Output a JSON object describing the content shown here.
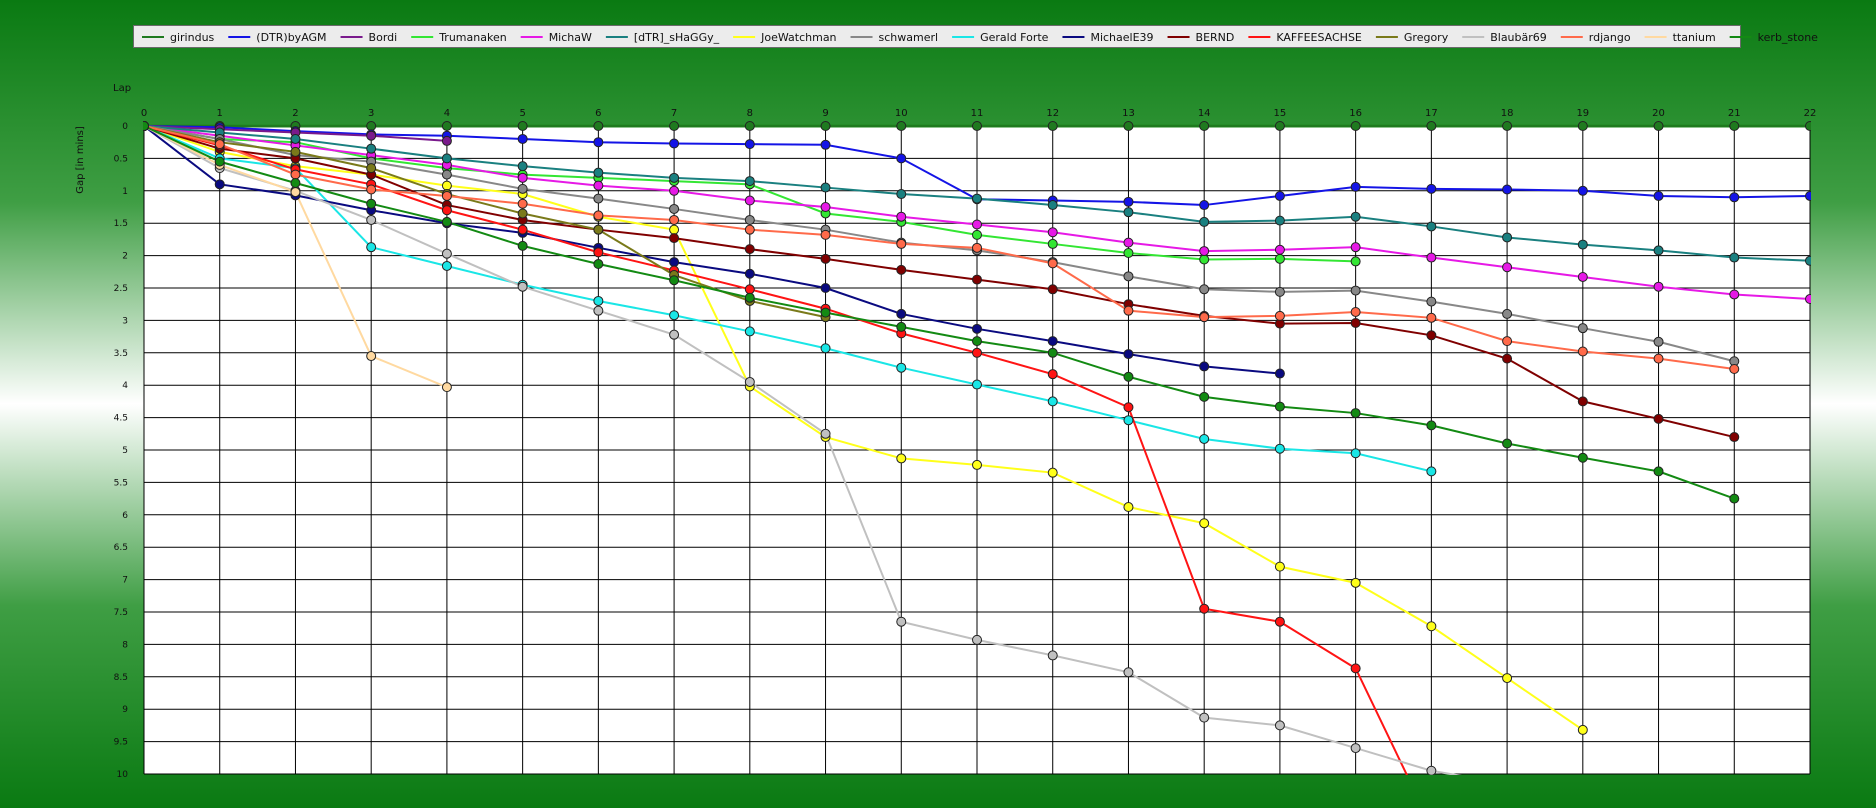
{
  "chart_data": {
    "type": "line",
    "x_label": "Lap",
    "y_label": "Gap [in mins]",
    "x": [
      0,
      1,
      2,
      3,
      4,
      5,
      6,
      7,
      8,
      9,
      10,
      11,
      12,
      13,
      14,
      15,
      16,
      17,
      18,
      19,
      20,
      21,
      22
    ],
    "xlim": [
      0,
      22
    ],
    "ylim": [
      0,
      10
    ],
    "y_inverted": true,
    "y_ticks": [
      "0",
      "0.5",
      "1",
      "1.5",
      "2",
      "2.5",
      "3",
      "3.5",
      "4",
      "4.5",
      "5",
      "5.5",
      "6",
      "6.5",
      "7",
      "7.5",
      "8",
      "8.5",
      "9",
      "9.5",
      "10"
    ],
    "grid": true,
    "legend_position": "top",
    "series": [
      {
        "name": "girindus",
        "color": "#1f7a1f",
        "values": [
          0,
          0,
          0,
          0,
          0,
          0,
          0,
          0,
          0,
          0,
          0,
          0,
          0,
          0,
          0,
          0,
          0,
          0,
          0,
          0,
          0,
          0,
          0
        ]
      },
      {
        "name": "(DTR)byAGM",
        "color": "#1414e6",
        "values": [
          0,
          0.02,
          0.08,
          0.13,
          0.15,
          0.2,
          0.25,
          0.27,
          0.28,
          0.29,
          0.5,
          1.13,
          1.15,
          1.17,
          1.22,
          1.08,
          0.94,
          0.97,
          0.98,
          1.0,
          1.08,
          1.1,
          1.08
        ]
      },
      {
        "name": "Bordi",
        "color": "#7a1a8c",
        "values": [
          0,
          0.05,
          0.1,
          0.15,
          0.23
        ]
      },
      {
        "name": "Trumanaken",
        "color": "#33e633",
        "values": [
          0,
          0.2,
          0.25,
          0.5,
          0.65,
          0.75,
          0.8,
          0.85,
          0.9,
          1.35,
          1.48,
          1.68,
          1.82,
          1.96,
          2.06,
          2.05,
          2.09
        ]
      },
      {
        "name": "MichaW",
        "color": "#e619e6",
        "values": [
          0,
          0.15,
          0.3,
          0.45,
          0.6,
          0.8,
          0.92,
          1.0,
          1.15,
          1.25,
          1.4,
          1.52,
          1.64,
          1.8,
          1.93,
          1.91,
          1.87,
          2.03,
          2.18,
          2.33,
          2.48,
          2.6,
          2.67
        ]
      },
      {
        "name": "[dTR]_sHaGGy_",
        "color": "#1a8080",
        "values": [
          0,
          0.1,
          0.2,
          0.35,
          0.5,
          0.62,
          0.72,
          0.8,
          0.85,
          0.95,
          1.05,
          1.12,
          1.22,
          1.33,
          1.48,
          1.46,
          1.4,
          1.55,
          1.72,
          1.83,
          1.92,
          2.03,
          2.08
        ]
      },
      {
        "name": "JoeWatchman",
        "color": "#ffff1a",
        "values": [
          0,
          0.4,
          0.62,
          0.75,
          0.92,
          1.05,
          1.4,
          1.6,
          4.02,
          4.8,
          5.13,
          5.23,
          5.35,
          5.88,
          6.13,
          6.8,
          7.05,
          7.72,
          8.52,
          9.32
        ]
      },
      {
        "name": "schwamerl",
        "color": "#888888",
        "values": [
          0,
          0.2,
          0.45,
          0.55,
          0.75,
          0.97,
          1.12,
          1.28,
          1.45,
          1.6,
          1.8,
          1.92,
          2.1,
          2.32,
          2.52,
          2.56,
          2.54,
          2.71,
          2.9,
          3.12,
          3.33,
          3.63
        ]
      },
      {
        "name": "Gerald Forte",
        "color": "#1ae6e6",
        "values": [
          0,
          0.5,
          0.65,
          1.87,
          2.16,
          2.45,
          2.7,
          2.92,
          3.17,
          3.43,
          3.73,
          3.99,
          4.25,
          4.54,
          4.83,
          4.98,
          5.05,
          5.33
        ]
      },
      {
        "name": "MichaelE39",
        "color": "#0a0a80",
        "values": [
          0,
          0.9,
          1.07,
          1.3,
          1.5,
          1.65,
          1.88,
          2.1,
          2.28,
          2.5,
          2.9,
          3.13,
          3.32,
          3.52,
          3.71,
          3.82
        ]
      },
      {
        "name": "BERND",
        "color": "#800000",
        "values": [
          0,
          0.35,
          0.5,
          0.75,
          1.22,
          1.45,
          1.6,
          1.73,
          1.9,
          2.05,
          2.22,
          2.37,
          2.52,
          2.75,
          2.93,
          3.05,
          3.04,
          3.23,
          3.59,
          4.25,
          4.52,
          4.8
        ]
      },
      {
        "name": "KAFFEESACHSE",
        "color": "#ff1414",
        "values": [
          0,
          0.3,
          0.67,
          0.9,
          1.3,
          1.6,
          1.95,
          2.23,
          2.52,
          2.82,
          3.2,
          3.5,
          3.83,
          4.34,
          7.45,
          7.65,
          8.37,
          10.8
        ]
      },
      {
        "name": "Gregory",
        "color": "#7a7a1a",
        "values": [
          0,
          0.25,
          0.4,
          0.65,
          1.05,
          1.35,
          1.6,
          2.3,
          2.7,
          2.95
        ]
      },
      {
        "name": "Blaubär69",
        "color": "#c0c0c0",
        "values": [
          0,
          0.65,
          1.0,
          1.45,
          1.97,
          2.48,
          2.85,
          3.22,
          3.95,
          4.75,
          7.65,
          7.93,
          8.17,
          8.43,
          9.13,
          9.25,
          9.6,
          9.95,
          10.15
        ]
      },
      {
        "name": "rdjango",
        "color": "#ff6a4a",
        "values": [
          0,
          0.28,
          0.75,
          0.98,
          1.08,
          1.2,
          1.38,
          1.45,
          1.6,
          1.68,
          1.82,
          1.88,
          2.12,
          2.85,
          2.95,
          2.93,
          2.87,
          2.96,
          3.32,
          3.48,
          3.59,
          3.75
        ]
      },
      {
        "name": "ttanium",
        "color": "#ffd9a0",
        "values": [
          0,
          0.6,
          1.02,
          3.55,
          4.03
        ]
      },
      {
        "name": "kerb_stone",
        "color": "#138a13",
        "values": [
          0,
          0.55,
          0.88,
          1.2,
          1.48,
          1.85,
          2.13,
          2.38,
          2.65,
          2.88,
          3.1,
          3.32,
          3.5,
          3.87,
          4.18,
          4.33,
          4.43,
          4.62,
          4.9,
          5.12,
          5.33,
          5.75
        ]
      }
    ]
  }
}
